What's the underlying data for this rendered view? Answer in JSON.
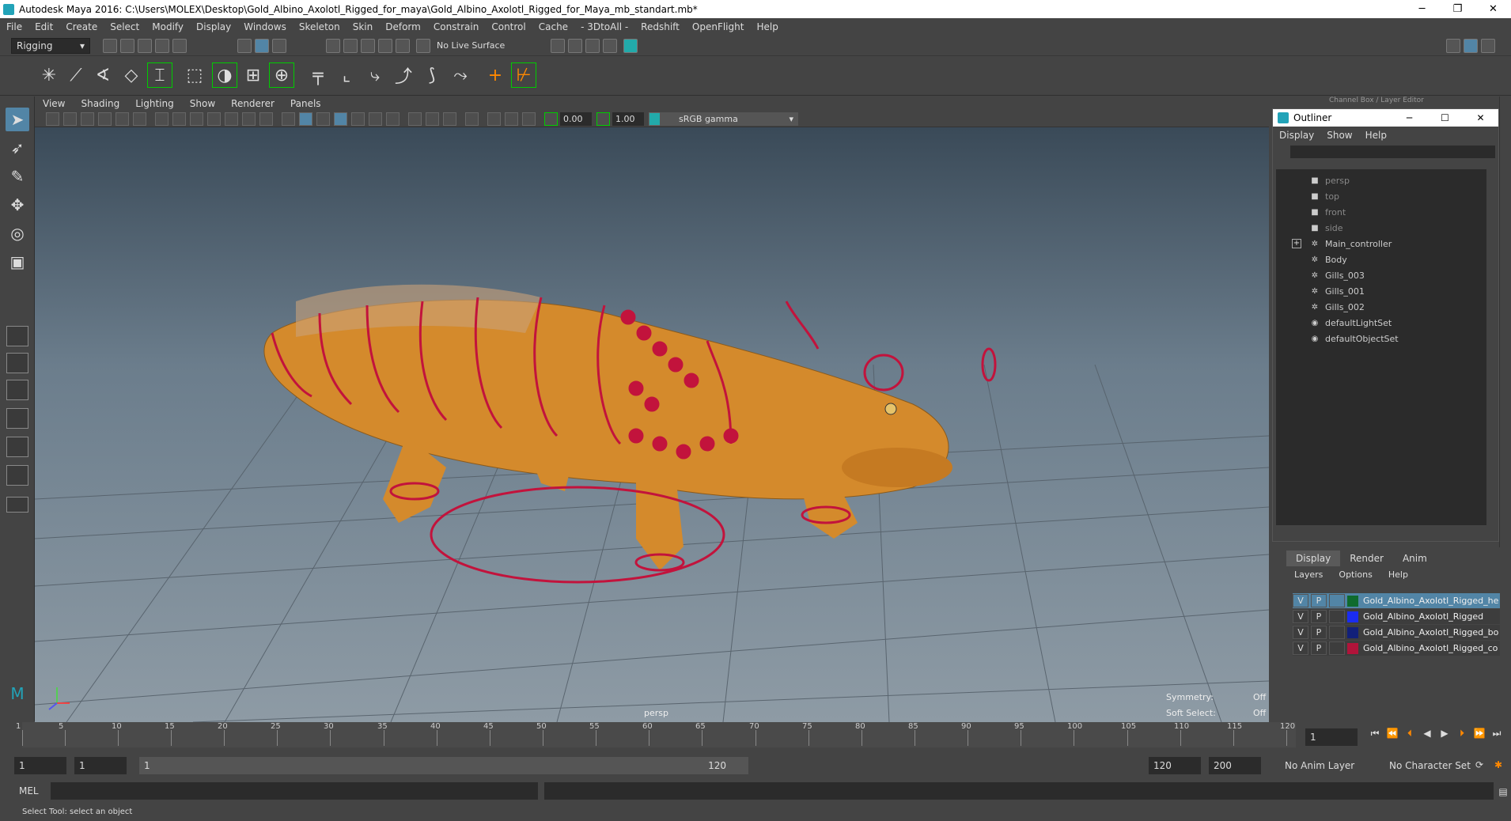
{
  "window": {
    "title": "Autodesk Maya 2016: C:\\Users\\MOLEX\\Desktop\\Gold_Albino_Axolotl_Rigged_for_maya\\Gold_Albino_Axolotl_Rigged_for_Maya_mb_standart.mb*",
    "minimize": "─",
    "maximize": "❐",
    "close": "✕"
  },
  "menubar": [
    "File",
    "Edit",
    "Create",
    "Select",
    "Modify",
    "Display",
    "Windows",
    "Skeleton",
    "Skin",
    "Deform",
    "Constrain",
    "Control",
    "Cache",
    "- 3DtoAll -",
    "Redshift",
    "OpenFlight",
    "Help"
  ],
  "statusline": {
    "mode": "Rigging",
    "live_surface": "No Live Surface"
  },
  "viewport": {
    "menu": [
      "View",
      "Shading",
      "Lighting",
      "Show",
      "Renderer",
      "Panels"
    ],
    "field_a": "0.00",
    "field_b": "1.00",
    "color_space": "sRGB gamma",
    "camera_label": "persp",
    "hud": {
      "symmetry_label": "Symmetry:",
      "symmetry_value": "Off",
      "soft_select_label": "Soft Select:",
      "soft_select_value": "Off"
    }
  },
  "channel_box_title": "Channel Box / Layer Editor",
  "outliner": {
    "title": "Outliner",
    "menu": [
      "Display",
      "Show",
      "Help"
    ],
    "items": [
      {
        "label": "persp",
        "icon": "camera-icon",
        "dim": true
      },
      {
        "label": "top",
        "icon": "camera-icon",
        "dim": true
      },
      {
        "label": "front",
        "icon": "camera-icon",
        "dim": true
      },
      {
        "label": "side",
        "icon": "camera-icon",
        "dim": true
      },
      {
        "label": "Main_controller",
        "icon": "curve-icon",
        "dim": false,
        "expand": "+"
      },
      {
        "label": "Body",
        "icon": "mesh-icon",
        "dim": false
      },
      {
        "label": "Gills_003",
        "icon": "mesh-icon",
        "dim": false
      },
      {
        "label": "Gills_001",
        "icon": "mesh-icon",
        "dim": false
      },
      {
        "label": "Gills_002",
        "icon": "mesh-icon",
        "dim": false
      },
      {
        "label": "defaultLightSet",
        "icon": "set-icon",
        "dim": false
      },
      {
        "label": "defaultObjectSet",
        "icon": "set-icon",
        "dim": false
      }
    ]
  },
  "layers": {
    "tabs": [
      "Display",
      "Render",
      "Anim"
    ],
    "menu": [
      "Layers",
      "Options",
      "Help"
    ],
    "rows": [
      {
        "v": "V",
        "p": "P",
        "color": "#0f6b2e",
        "name": "Gold_Albino_Axolotl_Rigged_he",
        "selected": true
      },
      {
        "v": "V",
        "p": "P",
        "color": "#1a2cf0",
        "name": "Gold_Albino_Axolotl_Rigged",
        "selected": false
      },
      {
        "v": "V",
        "p": "P",
        "color": "#12207a",
        "name": "Gold_Albino_Axolotl_Rigged_bo",
        "selected": false
      },
      {
        "v": "V",
        "p": "P",
        "color": "#b0143a",
        "name": "Gold_Albino_Axolotl_Rigged_co",
        "selected": false
      }
    ]
  },
  "timeline": {
    "start": 1,
    "end": 120,
    "ticks": [
      "1",
      "5",
      "10",
      "15",
      "20",
      "25",
      "30",
      "35",
      "40",
      "45",
      "50",
      "55",
      "60",
      "65",
      "70",
      "75",
      "80",
      "85",
      "90",
      "95",
      "100",
      "105",
      "110",
      "115",
      "120"
    ],
    "current_frame": "1"
  },
  "range": {
    "start": "1",
    "inner_start": "1",
    "slider_start": "1",
    "slider_end": "120",
    "end": "120",
    "max": "200",
    "anim_layer": "No Anim Layer",
    "char_set": "No Character Set"
  },
  "cmd": {
    "lang": "MEL"
  },
  "help_line": "Select Tool: select an object"
}
